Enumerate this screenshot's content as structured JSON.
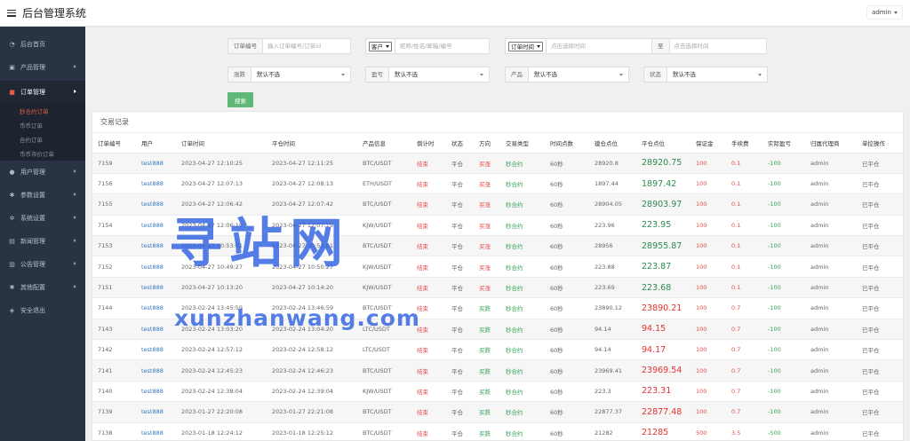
{
  "header": {
    "title": "后台管理系统",
    "user": "admin"
  },
  "sidebar": {
    "items": [
      {
        "label": "后台首页",
        "icon": "dashboard-icon"
      },
      {
        "label": "产品管理",
        "icon": "cart-icon"
      },
      {
        "label": "订单管理",
        "icon": "order-icon"
      },
      {
        "label": "用户管理",
        "icon": "user-icon"
      },
      {
        "label": "参数设置",
        "icon": "gear-icon"
      },
      {
        "label": "系统设置",
        "icon": "cogs-icon"
      },
      {
        "label": "新闻管理",
        "icon": "news-icon"
      },
      {
        "label": "公告管理",
        "icon": "notice-icon"
      },
      {
        "label": "其他配置",
        "icon": "settings-icon"
      },
      {
        "label": "安全退出",
        "icon": "logout-icon"
      }
    ],
    "sub_items": [
      "秒合约订单",
      "币币订单",
      "合约订单",
      "币币市价订单"
    ]
  },
  "filters": {
    "order_no_label": "订单编号",
    "order_no_placeholder": "输入订单编号/订单id",
    "customer_select": "客户",
    "customer_placeholder": "昵称/姓名/邮箱/编号",
    "time_select": "订单时间",
    "start_placeholder": "点击选择时间",
    "to_label": "至",
    "end_placeholder": "点击选择时间",
    "rise_fall_label": "涨跌",
    "rise_fall_value": "默认不选",
    "profit_label": "盈亏",
    "profit_value": "默认不选",
    "product_label": "产品",
    "product_value": "默认不选",
    "status_label": "状态",
    "status_value": "默认不选",
    "search_label": "搜索"
  },
  "panel": {
    "title": "交易记录"
  },
  "table": {
    "columns": [
      "订单编号",
      "用户",
      "订单时间",
      "平仓时间",
      "产品信息",
      "倒计时",
      "状态",
      "方向",
      "交易类型",
      "时间点数",
      "建仓点位",
      "平仓点位",
      "保证金",
      "手续费",
      "实际盈亏",
      "归属代理商",
      "单控操作"
    ],
    "rows": [
      [
        "7159",
        "test888",
        "2023-04-27 12:10:25",
        "2023-04-27 12:11:25",
        "BTC/USDT",
        "结束",
        "平仓",
        "买涨",
        "秒合约",
        "60秒",
        "28920.8",
        "28920.75",
        "100",
        "0.1",
        "-100",
        "admin",
        "已平仓"
      ],
      [
        "7156",
        "test888",
        "2023-04-27 12:07:13",
        "2023-04-27 12:08:13",
        "ETH/USDT",
        "结束",
        "平仓",
        "买涨",
        "秒合约",
        "60秒",
        "1897.44",
        "1897.42",
        "100",
        "0.1",
        "-100",
        "admin",
        "已平仓"
      ],
      [
        "7155",
        "test888",
        "2023-04-27 12:06:42",
        "2023-04-27 12:07:42",
        "BTC/USDT",
        "结束",
        "平仓",
        "买涨",
        "秒合约",
        "60秒",
        "28904.05",
        "28903.97",
        "100",
        "0.1",
        "-100",
        "admin",
        "已平仓"
      ],
      [
        "7154",
        "test888",
        "2023-04-27 12:06:19",
        "2023-04-27 12:07:19",
        "KJW/USDT",
        "结束",
        "平仓",
        "买涨",
        "秒合约",
        "60秒",
        "223.96",
        "223.95",
        "100",
        "0.1",
        "-100",
        "admin",
        "已平仓"
      ],
      [
        "7153",
        "test888",
        "2023-04-27 10:53:01",
        "2023-04-27 10:53:01",
        "BTC/USDT",
        "结束",
        "平仓",
        "买涨",
        "秒合约",
        "60秒",
        "28956",
        "28955.87",
        "100",
        "0.1",
        "-100",
        "admin",
        "已平仓"
      ],
      [
        "7152",
        "test888",
        "2023-04-27 10:49:27",
        "2023-04-27 10:50:27",
        "KJW/USDT",
        "结束",
        "平仓",
        "买涨",
        "秒合约",
        "60秒",
        "223.88",
        "223.87",
        "100",
        "0.1",
        "-100",
        "admin",
        "已平仓"
      ],
      [
        "7151",
        "test888",
        "2023-04-27 10:13:20",
        "2023-04-27 10:14:20",
        "KJW/USDT",
        "结束",
        "平仓",
        "买涨",
        "秒合约",
        "60秒",
        "223.69",
        "223.68",
        "100",
        "0.1",
        "-100",
        "admin",
        "已平仓"
      ],
      [
        "7144",
        "test888",
        "2023-02-24 13:45:59",
        "2023-02-24 13:46:59",
        "BTC/USDT",
        "结束",
        "平仓",
        "买跌",
        "秒合约",
        "60秒",
        "23890.12",
        "23890.21",
        "100",
        "0.7",
        "-100",
        "admin",
        "已平仓"
      ],
      [
        "7143",
        "test888",
        "2023-02-24 13:03:20",
        "2023-02-24 13:04:20",
        "LTC/USDT",
        "结束",
        "平仓",
        "买跌",
        "秒合约",
        "60秒",
        "94.14",
        "94.15",
        "100",
        "0.7",
        "-100",
        "admin",
        "已平仓"
      ],
      [
        "7142",
        "test888",
        "2023-02-24 12:57:12",
        "2023-02-24 12:58:12",
        "LTC/USDT",
        "结束",
        "平仓",
        "买跌",
        "秒合约",
        "60秒",
        "94.14",
        "94.17",
        "100",
        "0.7",
        "-100",
        "admin",
        "已平仓"
      ],
      [
        "7141",
        "test888",
        "2023-02-24 12:45:23",
        "2023-02-24 12:46:23",
        "BTC/USDT",
        "结束",
        "平仓",
        "买跌",
        "秒合约",
        "60秒",
        "23969.41",
        "23969.54",
        "100",
        "0.7",
        "-100",
        "admin",
        "已平仓"
      ],
      [
        "7140",
        "test888",
        "2023-02-24 12:38:04",
        "2023-02-24 12:39:04",
        "KJW/USDT",
        "结束",
        "平仓",
        "买跌",
        "秒合约",
        "60秒",
        "223.3",
        "223.31",
        "100",
        "0.7",
        "-100",
        "admin",
        "已平仓"
      ],
      [
        "7139",
        "test888",
        "2023-01-27 22:20:08",
        "2023-01-27 22:21:08",
        "BTC/USDT",
        "结束",
        "平仓",
        "买跌",
        "秒合约",
        "60秒",
        "22877.37",
        "22877.48",
        "100",
        "0.7",
        "-100",
        "admin",
        "已平仓"
      ],
      [
        "7138",
        "test888",
        "2023-01-18 12:24:12",
        "2023-01-18 12:25:12",
        "BTC/USDT",
        "结束",
        "平仓",
        "买跌",
        "秒合约",
        "60秒",
        "21282",
        "21285",
        "500",
        "3.5",
        "-500",
        "admin",
        "已平仓"
      ]
    ]
  },
  "watermark": {
    "line1": "寻站网",
    "line2": "xunzhanwang.com"
  },
  "colors": {
    "sidebar_bg": "#2a3344",
    "accent_red": "#e64a4a",
    "accent_green": "#3aa35a",
    "link_blue": "#3479c4",
    "search_btn": "#5fb878"
  }
}
